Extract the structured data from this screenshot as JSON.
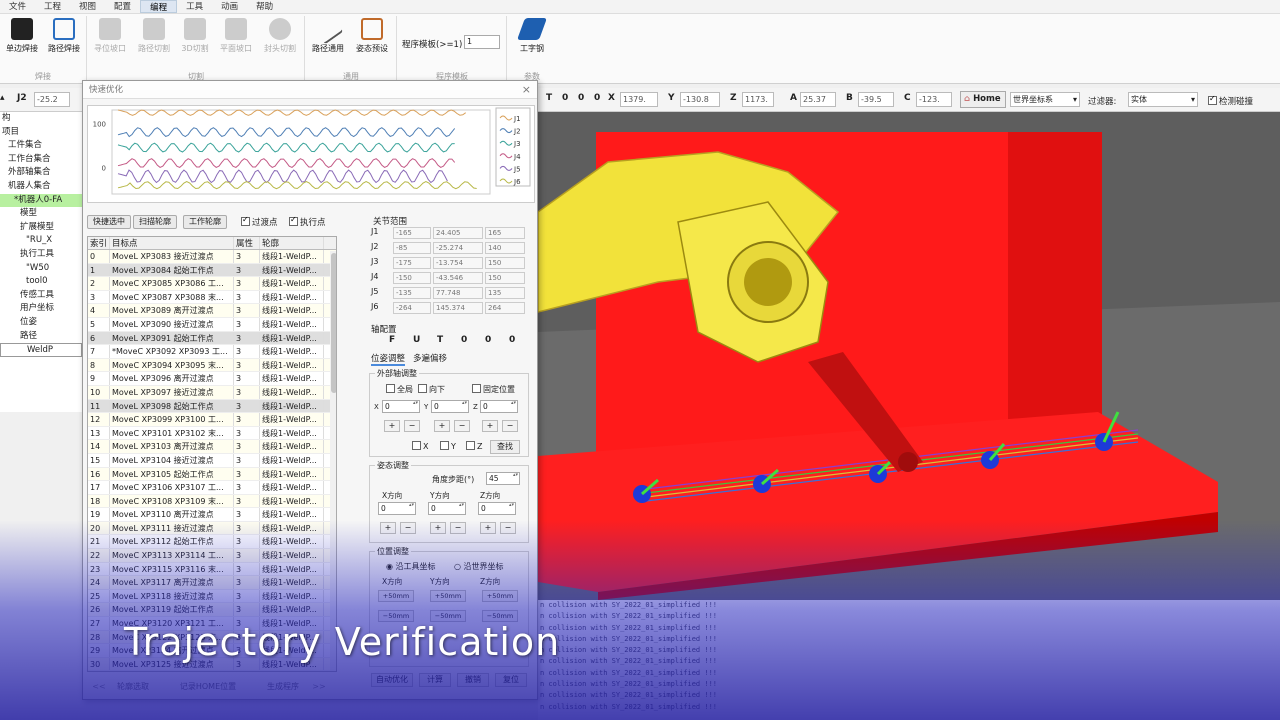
{
  "menu": [
    "文件",
    "工程",
    "视图",
    "配置",
    "编程",
    "工具",
    "动画",
    "帮助"
  ],
  "ribbon": {
    "buttons": [
      "单边焊接",
      "路径焊接",
      "寻位坡口",
      "路径切割",
      "3D切割",
      "平面坡口",
      "封头切割",
      "路径通用",
      "姿态预设",
      "工字钢"
    ],
    "groups": [
      "焊接",
      "切割",
      "通用",
      "程序模板",
      "参数"
    ],
    "template_label": "程序模板(>=1)",
    "template_value": "1"
  },
  "coordbar": {
    "j2_label": "J2",
    "j2_value": "-25.2",
    "config": [
      "T",
      "0",
      "0",
      "0"
    ],
    "axes": [
      {
        "label": "X",
        "value": "1379."
      },
      {
        "label": "Y",
        "value": "-130.8"
      },
      {
        "label": "Z",
        "value": "1173."
      },
      {
        "label": "A",
        "value": "25.37"
      },
      {
        "label": "B",
        "value": "-39.5"
      },
      {
        "label": "C",
        "value": "-123."
      }
    ],
    "home": "Home",
    "frame": "世界坐标系",
    "filter_label": "过滤器:",
    "filter_value": "实体",
    "collision_label": "检测碰撞"
  },
  "tree": [
    "构",
    "项目",
    "工件集合",
    "工作台集合",
    "外部轴集合",
    "机器人集合",
    "*机器人0-FA",
    "模型",
    "扩展模型",
    "\"RU_X",
    "执行工具",
    "\"W50",
    "tool0",
    "传感工具",
    "用户坐标",
    "位姿",
    "路径",
    "WeldP"
  ],
  "dialog": {
    "title": "快速优化",
    "close": "×",
    "chart_legend": [
      "J1",
      "J2",
      "J3",
      "J4",
      "J5",
      "J6"
    ],
    "toolbar": {
      "quick_select": "快捷选中",
      "scan_contour": "扫描轮廓",
      "work_contour": "工作轮廓",
      "via_points": "过渡点",
      "exec_points": "执行点"
    },
    "table_headers": [
      "索引",
      "目标点",
      "属性",
      "轮廓"
    ],
    "rows": [
      [
        "0",
        "MoveL XP3083 接近过渡点",
        "3",
        "线段1-WeldP..."
      ],
      [
        "1",
        "MoveL XP3084 起始工作点",
        "3",
        "线段1-WeldP..."
      ],
      [
        "2",
        "MoveC XP3085 XP3086 工...",
        "3",
        "线段1-WeldP..."
      ],
      [
        "3",
        "MoveC XP3087 XP3088 末...",
        "3",
        "线段1-WeldP..."
      ],
      [
        "4",
        "MoveL XP3089 离开过渡点",
        "3",
        "线段1-WeldP..."
      ],
      [
        "5",
        "MoveL XP3090 接近过渡点",
        "3",
        "线段1-WeldP..."
      ],
      [
        "6",
        "MoveL XP3091 起始工作点",
        "3",
        "线段1-WeldP..."
      ],
      [
        "7",
        "*MoveC XP3092 XP3093 工...",
        "3",
        "线段1-WeldP..."
      ],
      [
        "8",
        "MoveC XP3094 XP3095 末...",
        "3",
        "线段1-WeldP..."
      ],
      [
        "9",
        "MoveL XP3096 离开过渡点",
        "3",
        "线段1-WeldP..."
      ],
      [
        "10",
        "MoveL XP3097 接近过渡点",
        "3",
        "线段1-WeldP..."
      ],
      [
        "11",
        "MoveL XP3098 起始工作点",
        "3",
        "线段1-WeldP..."
      ],
      [
        "12",
        "MoveC XP3099 XP3100 工...",
        "3",
        "线段1-WeldP..."
      ],
      [
        "13",
        "MoveC XP3101 XP3102 末...",
        "3",
        "线段1-WeldP..."
      ],
      [
        "14",
        "MoveL XP3103 离开过渡点",
        "3",
        "线段1-WeldP..."
      ],
      [
        "15",
        "MoveL XP3104 接近过渡点",
        "3",
        "线段1-WeldP..."
      ],
      [
        "16",
        "MoveL XP3105 起始工作点",
        "3",
        "线段1-WeldP..."
      ],
      [
        "17",
        "MoveC XP3106 XP3107 工...",
        "3",
        "线段1-WeldP..."
      ],
      [
        "18",
        "MoveC XP3108 XP3109 末...",
        "3",
        "线段1-WeldP..."
      ],
      [
        "19",
        "MoveL XP3110 离开过渡点",
        "3",
        "线段1-WeldP..."
      ],
      [
        "20",
        "MoveL XP3111 接近过渡点",
        "3",
        "线段1-WeldP..."
      ],
      [
        "21",
        "MoveL XP3112 起始工作点",
        "3",
        "线段1-WeldP..."
      ],
      [
        "22",
        "MoveC XP3113 XP3114 工...",
        "3",
        "线段1-WeldP..."
      ],
      [
        "23",
        "MoveC XP3115 XP3116 末...",
        "3",
        "线段1-WeldP..."
      ],
      [
        "24",
        "MoveL XP3117 离开过渡点",
        "3",
        "线段1-WeldP..."
      ],
      [
        "25",
        "MoveL XP3118 接近过渡点",
        "3",
        "线段1-WeldP..."
      ],
      [
        "26",
        "MoveL XP3119 起始工作点",
        "3",
        "线段1-WeldP..."
      ],
      [
        "27",
        "MoveC XP3120 XP3121 工...",
        "3",
        "线段1-WeldP..."
      ],
      [
        "28",
        "MoveC XP3122 XP3123 末...",
        "3",
        "线段1-WeldP..."
      ],
      [
        "29",
        "MoveL XP3124 离开过渡点",
        "3",
        "线段1-WeldP..."
      ],
      [
        "30",
        "MoveL XP3125 接近过渡点",
        "3",
        "线段1-WeldP..."
      ]
    ],
    "bottom": {
      "prev": "<<",
      "contour_select": "轮廓选取",
      "record_home": "记录HOME位置",
      "gen_program": "生成程序",
      "next": ">>"
    },
    "joint_range_title": "关节范围",
    "joints": [
      {
        "name": "J1",
        "min": "-165",
        "cur": "24.405",
        "max": "165"
      },
      {
        "name": "J2",
        "min": "-85",
        "cur": "-25.274",
        "max": "140"
      },
      {
        "name": "J3",
        "min": "-175",
        "cur": "-13.754",
        "max": "150"
      },
      {
        "name": "J4",
        "min": "-150",
        "cur": "-43.546",
        "max": "150"
      },
      {
        "name": "J5",
        "min": "-135",
        "cur": "77.748",
        "max": "135"
      },
      {
        "name": "J6",
        "min": "-264",
        "cur": "145.374",
        "max": "264"
      }
    ],
    "axis_config_title": "轴配置",
    "axis_config": [
      "F",
      "U",
      "T",
      "0",
      "0",
      "0"
    ],
    "tabs": [
      "位姿调整",
      "多遍偏移"
    ],
    "ext_axis": {
      "title": "外部轴调整",
      "all": "全局",
      "down": "向下",
      "fixed": "固定位置",
      "x": "X",
      "y": "Y",
      "z": "Z",
      "xv": "0",
      "yv": "0",
      "zv": "0",
      "plus": "+",
      "minus": "−",
      "cx": "X",
      "cy": "Y",
      "cz": "Z",
      "find": "查找"
    },
    "pose": {
      "title": "姿态调整",
      "step_label": "角度步距(°)",
      "step_value": "45",
      "xdir": "X方向",
      "ydir": "Y方向",
      "zdir": "Z方向",
      "xv": "0",
      "yv": "0",
      "zv": "0",
      "plus": "+",
      "minus": "−"
    },
    "pos": {
      "title": "位置调整",
      "tool": "沿工具坐标",
      "world": "沿世界坐标",
      "xdir": "X方向",
      "ydir": "Y方向",
      "zdir": "Z方向",
      "p50": "+50mm",
      "m50": "−50mm"
    },
    "actions": [
      "自动优化",
      "计算",
      "撤销",
      "复位"
    ]
  },
  "log_lines": [
    "n collision with SY_2022_01_simplified !!!",
    "n collision with SY_2022_01_simplified !!!",
    "n collision with SY_2022_01_simplified !!!",
    "n collision with SY_2022_01_simplified !!!",
    "n collision with SY_2022_01_simplified !!!",
    "n collision with SY_2022_01_simplified !!!",
    "n collision with SY_2022_01_simplified !!!",
    "n collision with SY_2022_01_simplified !!!",
    "n collision with SY_2022_01_simplified !!!",
    "n collision with SY_2022_01_simplified !!!"
  ],
  "caption": "Trajectory Verification",
  "chart_data": {
    "type": "line",
    "yticks": [
      "100",
      "0"
    ],
    "ylim": [
      -60,
      130
    ],
    "legend": [
      "J1",
      "J2",
      "J3",
      "J4",
      "J5",
      "J6"
    ],
    "colors": [
      "#d9a15b",
      "#4f7fb5",
      "#3aa39a",
      "#c45a86",
      "#8a6bb7",
      "#b8b848"
    ],
    "series": [
      {
        "name": "J1",
        "base": 124,
        "amp": 6,
        "x_end": 0.95
      },
      {
        "name": "J2",
        "base": 80,
        "amp": 10,
        "x_end": 0.92
      },
      {
        "name": "J3",
        "base": 45,
        "amp": 10,
        "x_end": 0.92
      },
      {
        "name": "J4",
        "base": 10,
        "amp": 10,
        "x_end": 0.92
      },
      {
        "name": "J5",
        "base": -20,
        "amp": 14,
        "x_end": 0.9
      },
      {
        "name": "J6",
        "base": -40,
        "amp": 8,
        "x_end": 0.98
      }
    ]
  }
}
